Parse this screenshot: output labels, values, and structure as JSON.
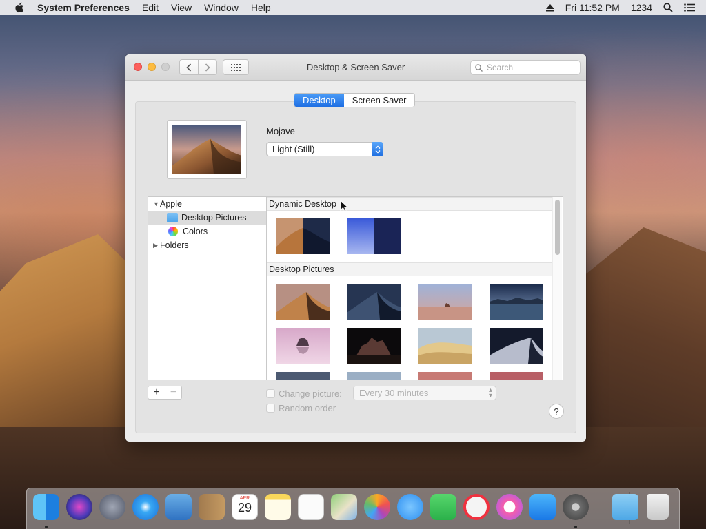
{
  "menubar": {
    "app_name": "System Preferences",
    "items": [
      "Edit",
      "View",
      "Window",
      "Help"
    ],
    "clock": "Fri 11:52 PM",
    "user": "1234"
  },
  "window": {
    "title": "Desktop & Screen Saver",
    "search_placeholder": "Search",
    "tabs": [
      {
        "label": "Desktop",
        "active": true
      },
      {
        "label": "Screen Saver",
        "active": false
      }
    ],
    "wallpaper_name": "Mojave",
    "appearance_popup": "Light (Still)",
    "sources": {
      "items": [
        {
          "label": "Apple",
          "expanded": true
        },
        {
          "label": "Desktop Pictures",
          "selected": true
        },
        {
          "label": "Colors"
        },
        {
          "label": "Folders",
          "expanded": false
        }
      ]
    },
    "sections": {
      "dynamic": "Dynamic Desktop",
      "pictures": "Desktop Pictures"
    },
    "add_button": "+",
    "remove_button": "−",
    "change_picture_label": "Change picture:",
    "interval_value": "Every 30 minutes",
    "random_order_label": "Random order",
    "help_label": "?"
  },
  "colors": {
    "accent": "#1f6fe3",
    "close": "#fc605c",
    "minimize": "#fdbc40"
  },
  "dock": {
    "apps": [
      "finder-icon",
      "siri-icon",
      "launchpad-icon",
      "safari-icon",
      "mail-icon",
      "contacts-icon",
      "calendar-icon",
      "notes-icon",
      "reminders-icon",
      "maps-icon",
      "photos-icon",
      "messages-icon",
      "facetime-icon",
      "news-icon",
      "itunes-icon",
      "appstore-icon",
      "system-preferences-icon",
      "downloads-icon",
      "trash-icon"
    ],
    "calendar_month": "APR",
    "calendar_day": "29"
  }
}
